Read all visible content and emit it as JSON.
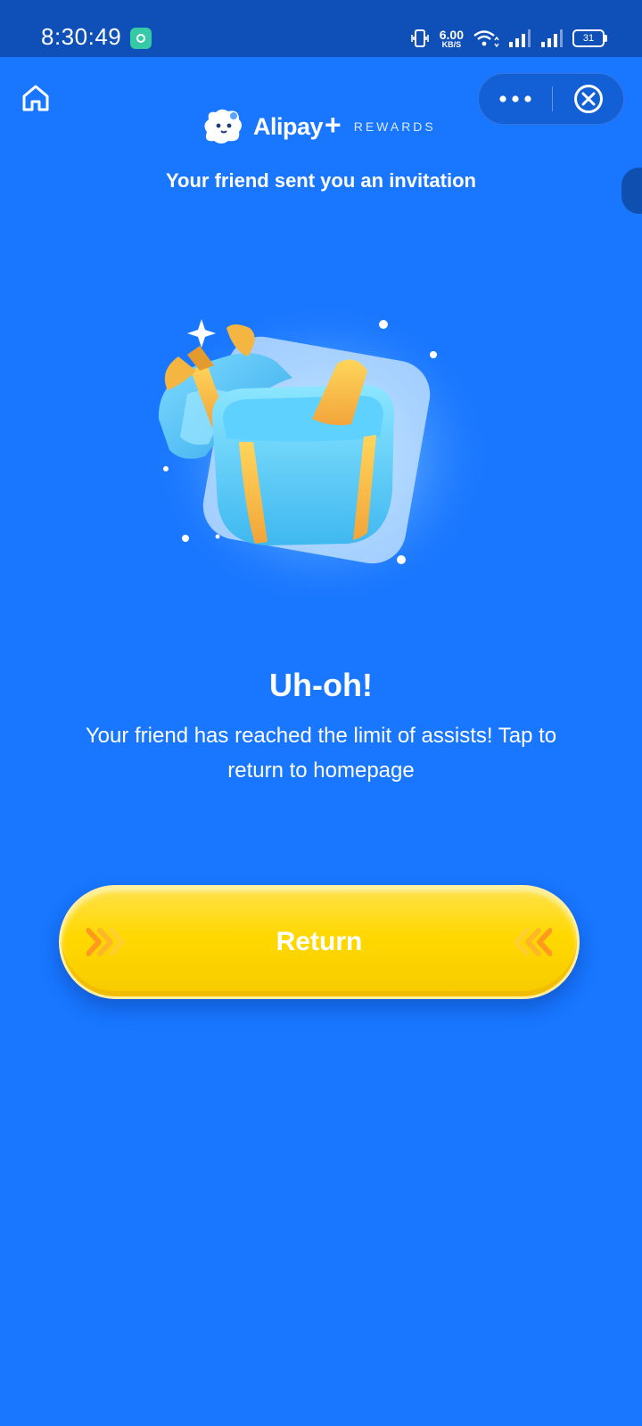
{
  "status_bar": {
    "time": "8:30:49",
    "net_speed_value": "6.00",
    "net_speed_unit": "KB/S",
    "battery_level": "31"
  },
  "header": {
    "brand_name": "Alipay",
    "brand_suffix": "+",
    "brand_tagline": "REWARDS",
    "invite_message": "Your friend sent you an invitation"
  },
  "icons": {
    "home": "home-icon",
    "more": "more-dots-icon",
    "close": "close-circle-icon",
    "gift": "open-gift-box-illustration"
  },
  "result": {
    "title": "Uh-oh!",
    "message": "Your friend has reached the limit of assists! Tap to return to homepage"
  },
  "actions": {
    "return_label": "Return"
  },
  "colors": {
    "background": "#1876FF",
    "status_bar": "#0F4FB8",
    "button": "#FFD800",
    "chevron": "#FF9A1F"
  }
}
